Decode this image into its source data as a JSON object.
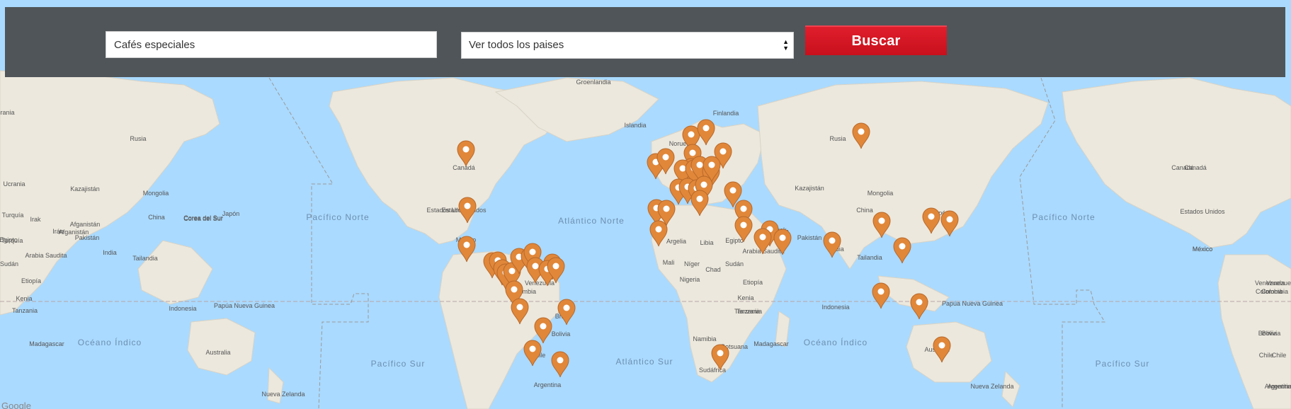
{
  "search": {
    "query_value": "Cafés especiales",
    "country_selected": "Ver todos los paises",
    "button_label": "Buscar"
  },
  "map": {
    "ocean_labels": [
      "Pacífico Norte",
      "Atlántico Norte",
      "Pacífico Sur",
      "Atlántico Sur",
      "Océano Índico",
      "Pacífico Norte",
      "Pacífico Sur",
      "Océano Índico"
    ],
    "country_labels": [
      "Groenlandia",
      "Islandia",
      "Finlandia",
      "Noruega",
      "Canadá",
      "Estados Unidos",
      "México",
      "Venezuela",
      "Colombia",
      "Brasil",
      "Bolivia",
      "Chile",
      "Argentina",
      "Argelia",
      "Libia",
      "Egipto",
      "Mali",
      "Níger",
      "Chad",
      "Sudán",
      "Nigeria",
      "Etiopía",
      "Kenia",
      "Tanzania",
      "Namibia",
      "Botsuana",
      "Madagascar",
      "Sudáfrica",
      "Irak",
      "Irán",
      "Arabia Saudita",
      "Pakistán",
      "Kazajistán",
      "Mongolia",
      "China",
      "India",
      "Tailandia",
      "Indonesia",
      "Australia",
      "Nueva Zelanda",
      "Papúa Nueva Guinea",
      "Japón",
      "Rusia",
      "Ucrania",
      "Turquía",
      "Afganistán",
      "Corea del Sur",
      "Estados Unidos",
      "Canadá",
      "México",
      "Venezuela",
      "Colombia",
      "Bolivia",
      "Chile",
      "Argentina",
      "Rusia",
      "Kazajistán",
      "Mongolia",
      "China",
      "Japón",
      "Corea del Sur",
      "Pakistán",
      "Afganistán",
      "Irán",
      "Irak",
      "Turquía",
      "Arabia Saudita",
      "India",
      "Tailandia",
      "Sudán",
      "Etiopía",
      "Kenia",
      "Tanzania",
      "Egipto",
      "Madagascar",
      "Indonesia",
      "Papúa Nueva Guinea",
      "Australia",
      "Nueva Zelanda",
      "Ucrania",
      "Canadá",
      "Estados Unidos",
      "México",
      "Venezuela",
      "Colombia",
      "Bolivia",
      "Chile",
      "Argentina",
      "Tanzania"
    ],
    "marker_count": 68,
    "marker_color": "#e0873a",
    "land_color": "#ece8dd",
    "water_color": "#aadaff",
    "footer_text": "Google"
  }
}
